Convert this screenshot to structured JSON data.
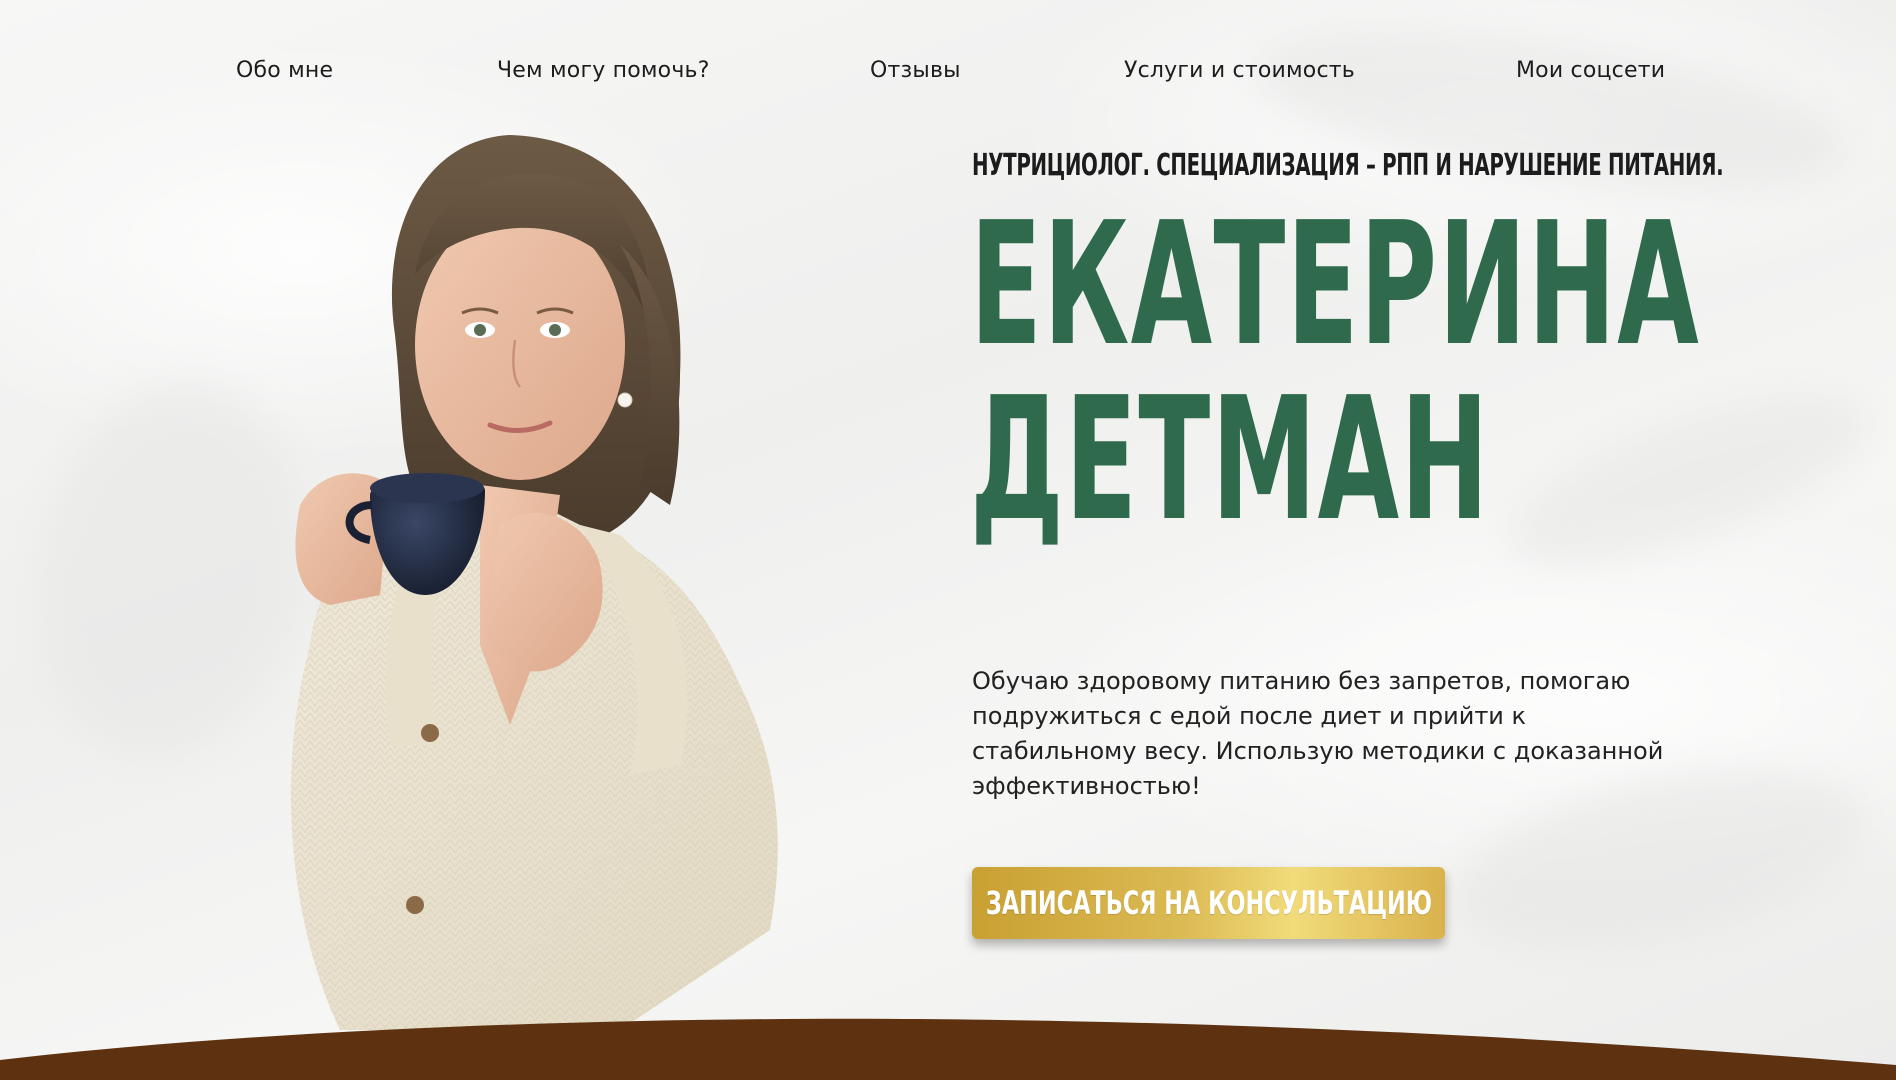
{
  "colors": {
    "accent_green": "#2e6a4b",
    "gold": "#d9b24c",
    "brown": "#5e3210",
    "text_dark": "#1c1c1c"
  },
  "nav": {
    "items": [
      {
        "label": "Обо мне"
      },
      {
        "label": "Чем могу помочь?"
      },
      {
        "label": "Отзывы"
      },
      {
        "label": "Услуги и стоимость"
      },
      {
        "label": "Мои соцсети"
      }
    ]
  },
  "hero": {
    "subtitle": "НУТРИЦИОЛОГ. СПЕЦИАЛИЗАЦИЯ – РПП И НАРУШЕНИЕ ПИТАНИЯ.",
    "first_name": "ЕКАТЕРИНА",
    "last_name": "ДЕТМАН",
    "description": "Обучаю здоровому питанию без запретов, помогаю подружиться с едой после диет и прийти к стабильному весу. Использую методики с доказанной эффективностью!",
    "cta_label": "ЗАПИСАТЬСЯ НА КОНСУЛЬТАЦИЮ",
    "portrait_icon": "woman-with-cup-portrait"
  }
}
